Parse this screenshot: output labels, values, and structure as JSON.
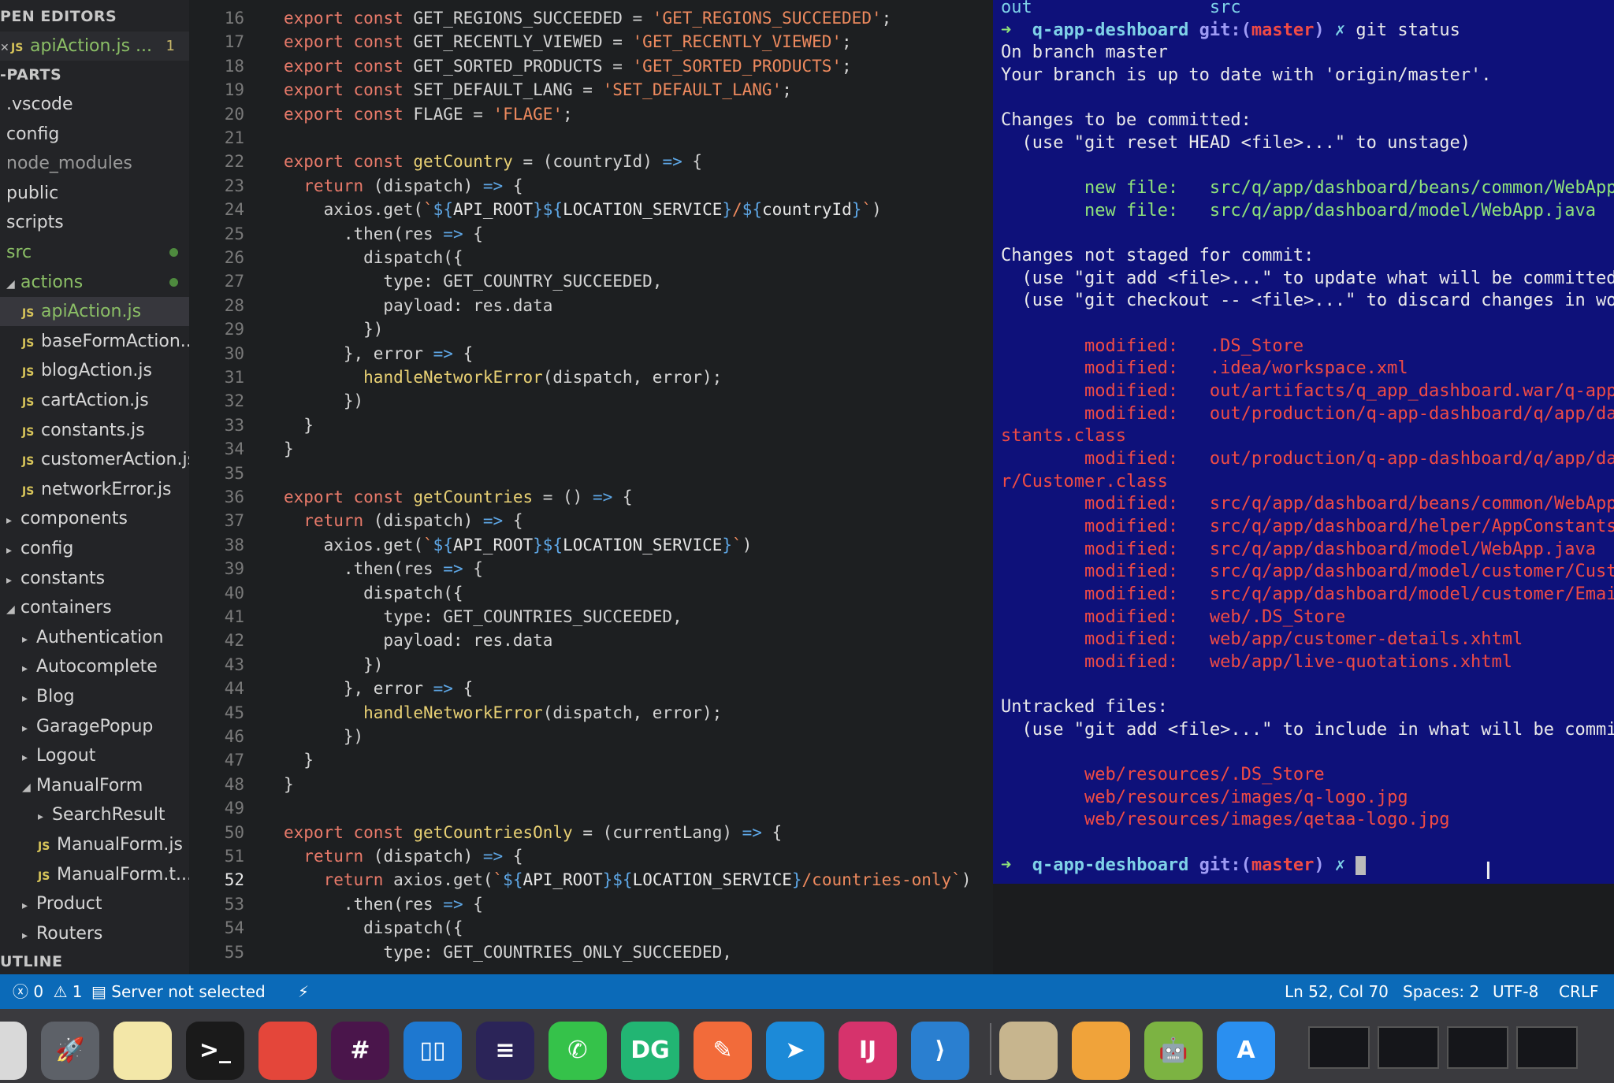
{
  "sidebar": {
    "open_editors_title": "PEN EDITORS",
    "open_editor": {
      "label": "apiAction.js ...",
      "badge": "1"
    },
    "project_title": "-PARTS",
    "outline_title": "UTLINE",
    "items": [
      {
        "label": ".vscode",
        "type": "folder",
        "indent": 0
      },
      {
        "label": "config",
        "type": "folder",
        "indent": 0
      },
      {
        "label": "node_modules",
        "type": "folder",
        "indent": 0,
        "dim": true
      },
      {
        "label": "public",
        "type": "folder",
        "indent": 0
      },
      {
        "label": "scripts",
        "type": "folder",
        "indent": 0
      },
      {
        "label": "src",
        "type": "folder",
        "indent": 0,
        "green": true,
        "dot": true
      },
      {
        "label": "actions",
        "type": "folder-open",
        "indent": 0,
        "green": true,
        "dot": true
      },
      {
        "label": "apiAction.js",
        "type": "file",
        "indent": 1,
        "green": true,
        "badge": "1",
        "selected": true
      },
      {
        "label": "baseFormAction...",
        "type": "file",
        "indent": 1
      },
      {
        "label": "blogAction.js",
        "type": "file",
        "indent": 1
      },
      {
        "label": "cartAction.js",
        "type": "file",
        "indent": 1
      },
      {
        "label": "constants.js",
        "type": "file",
        "indent": 1
      },
      {
        "label": "customerAction.js",
        "type": "file",
        "indent": 1
      },
      {
        "label": "networkError.js",
        "type": "file",
        "indent": 1
      },
      {
        "label": "components",
        "type": "folder",
        "indent": 0
      },
      {
        "label": "config",
        "type": "folder",
        "indent": 0
      },
      {
        "label": "constants",
        "type": "folder",
        "indent": 0
      },
      {
        "label": "containers",
        "type": "folder-open",
        "indent": 0
      },
      {
        "label": "Authentication",
        "type": "folder",
        "indent": 1
      },
      {
        "label": "Autocomplete",
        "type": "folder",
        "indent": 1
      },
      {
        "label": "Blog",
        "type": "folder",
        "indent": 1
      },
      {
        "label": "GaragePopup",
        "type": "folder",
        "indent": 1
      },
      {
        "label": "Logout",
        "type": "folder",
        "indent": 1
      },
      {
        "label": "ManualForm",
        "type": "folder-open",
        "indent": 1
      },
      {
        "label": "SearchResult",
        "type": "folder",
        "indent": 2
      },
      {
        "label": "ManualForm.js",
        "type": "file",
        "indent": 2
      },
      {
        "label": "ManualForm.t...",
        "type": "file",
        "indent": 2
      },
      {
        "label": "Product",
        "type": "folder",
        "indent": 1
      },
      {
        "label": "Routers",
        "type": "folder",
        "indent": 1
      }
    ]
  },
  "editor": {
    "current_line": 52,
    "lines": [
      {
        "n": 16,
        "text": "export const GET_REGIONS_SUCCEEDED = 'GET_REGIONS_SUCCEEDED';"
      },
      {
        "n": 17,
        "text": "export const GET_RECENTLY_VIEWED = 'GET_RECENTLY_VIEWED';"
      },
      {
        "n": 18,
        "text": "export const GET_SORTED_PRODUCTS = 'GET_SORTED_PRODUCTS';"
      },
      {
        "n": 19,
        "text": "export const SET_DEFAULT_LANG = 'SET_DEFAULT_LANG';"
      },
      {
        "n": 20,
        "text": "export const FLAGE = 'FLAGE';"
      },
      {
        "n": 21,
        "text": ""
      },
      {
        "n": 22,
        "text": "export const getCountry = (countryId) => {"
      },
      {
        "n": 23,
        "text": "  return (dispatch) => {"
      },
      {
        "n": 24,
        "text": "    axios.get(`${API_ROOT}${LOCATION_SERVICE}/${countryId}`)"
      },
      {
        "n": 25,
        "text": "      .then(res => {"
      },
      {
        "n": 26,
        "text": "        dispatch({"
      },
      {
        "n": 27,
        "text": "          type: GET_COUNTRY_SUCCEEDED,"
      },
      {
        "n": 28,
        "text": "          payload: res.data"
      },
      {
        "n": 29,
        "text": "        })"
      },
      {
        "n": 30,
        "text": "      }, error => {"
      },
      {
        "n": 31,
        "text": "        handleNetworkError(dispatch, error);"
      },
      {
        "n": 32,
        "text": "      })"
      },
      {
        "n": 33,
        "text": "  }"
      },
      {
        "n": 34,
        "text": "}"
      },
      {
        "n": 35,
        "text": ""
      },
      {
        "n": 36,
        "text": "export const getCountries = () => {"
      },
      {
        "n": 37,
        "text": "  return (dispatch) => {"
      },
      {
        "n": 38,
        "text": "    axios.get(`${API_ROOT}${LOCATION_SERVICE}`)"
      },
      {
        "n": 39,
        "text": "      .then(res => {"
      },
      {
        "n": 40,
        "text": "        dispatch({"
      },
      {
        "n": 41,
        "text": "          type: GET_COUNTRIES_SUCCEEDED,"
      },
      {
        "n": 42,
        "text": "          payload: res.data"
      },
      {
        "n": 43,
        "text": "        })"
      },
      {
        "n": 44,
        "text": "      }, error => {"
      },
      {
        "n": 45,
        "text": "        handleNetworkError(dispatch, error);"
      },
      {
        "n": 46,
        "text": "      })"
      },
      {
        "n": 47,
        "text": "  }"
      },
      {
        "n": 48,
        "text": "}"
      },
      {
        "n": 49,
        "text": ""
      },
      {
        "n": 50,
        "text": "export const getCountriesOnly = (currentLang) => {"
      },
      {
        "n": 51,
        "text": "  return (dispatch) => {"
      },
      {
        "n": 52,
        "text": "    return axios.get(`${API_ROOT}${LOCATION_SERVICE}/countries-only`)"
      },
      {
        "n": 53,
        "text": "      .then(res => {"
      },
      {
        "n": 54,
        "text": "        dispatch({"
      },
      {
        "n": 55,
        "text": "          type: GET_COUNTRIES_ONLY_SUCCEEDED,"
      }
    ]
  },
  "terminal": {
    "lines": [
      [
        {
          "t": "out                 src",
          "c": "t-cyan"
        }
      ],
      [
        {
          "t": "➜  ",
          "c": "t-green"
        },
        {
          "t": "q-app-deshboard ",
          "c": "t-cyan t-bold"
        },
        {
          "t": "git:(",
          "c": "t-purple t-bold"
        },
        {
          "t": "master",
          "c": "t-red t-bold"
        },
        {
          "t": ") ",
          "c": "t-purple t-bold"
        },
        {
          "t": "✗ ",
          "c": "t-cyan"
        },
        {
          "t": "git status",
          "c": ""
        }
      ],
      [
        {
          "t": "On branch master",
          "c": ""
        }
      ],
      [
        {
          "t": "Your branch is up to date with 'origin/master'.",
          "c": ""
        }
      ],
      [
        {
          "t": "",
          "c": ""
        }
      ],
      [
        {
          "t": "Changes to be committed:",
          "c": ""
        }
      ],
      [
        {
          "t": "  (use \"git reset HEAD <file>...\" to unstage)",
          "c": ""
        }
      ],
      [
        {
          "t": "",
          "c": ""
        }
      ],
      [
        {
          "t": "        new file:   src/q/app/dashboard/beans/common/WebApp",
          "c": "t-green"
        }
      ],
      [
        {
          "t": "        new file:   src/q/app/dashboard/model/WebApp.java",
          "c": "t-green"
        }
      ],
      [
        {
          "t": "",
          "c": ""
        }
      ],
      [
        {
          "t": "Changes not staged for commit:",
          "c": ""
        }
      ],
      [
        {
          "t": "  (use \"git add <file>...\" to update what will be committed",
          "c": ""
        }
      ],
      [
        {
          "t": "  (use \"git checkout -- <file>...\" to discard changes in wo",
          "c": ""
        }
      ],
      [
        {
          "t": "",
          "c": ""
        }
      ],
      [
        {
          "t": "        modified:   .DS_Store",
          "c": "t-red"
        }
      ],
      [
        {
          "t": "        modified:   .idea/workspace.xml",
          "c": "t-red"
        }
      ],
      [
        {
          "t": "        modified:   out/artifacts/q_app_dashboard.war/q-app",
          "c": "t-red"
        }
      ],
      [
        {
          "t": "        modified:   out/production/q-app-dashboard/q/app/da",
          "c": "t-red"
        }
      ],
      [
        {
          "t": "stants.class",
          "c": "t-red"
        }
      ],
      [
        {
          "t": "        modified:   out/production/q-app-dashboard/q/app/da",
          "c": "t-red"
        }
      ],
      [
        {
          "t": "r/Customer.class",
          "c": "t-red"
        }
      ],
      [
        {
          "t": "        modified:   src/q/app/dashboard/beans/common/WebApp",
          "c": "t-red"
        }
      ],
      [
        {
          "t": "        modified:   src/q/app/dashboard/helper/AppConstants",
          "c": "t-red"
        }
      ],
      [
        {
          "t": "        modified:   src/q/app/dashboard/model/WebApp.java",
          "c": "t-red"
        }
      ],
      [
        {
          "t": "        modified:   src/q/app/dashboard/model/customer/Cust",
          "c": "t-red"
        }
      ],
      [
        {
          "t": "        modified:   src/q/app/dashboard/model/customer/Emai",
          "c": "t-red"
        }
      ],
      [
        {
          "t": "        modified:   web/.DS_Store",
          "c": "t-red"
        }
      ],
      [
        {
          "t": "        modified:   web/app/customer-details.xhtml",
          "c": "t-red"
        }
      ],
      [
        {
          "t": "        modified:   web/app/live-quotations.xhtml",
          "c": "t-red"
        }
      ],
      [
        {
          "t": "",
          "c": ""
        }
      ],
      [
        {
          "t": "Untracked files:",
          "c": ""
        }
      ],
      [
        {
          "t": "  (use \"git add <file>...\" to include in what will be commi",
          "c": ""
        }
      ],
      [
        {
          "t": "",
          "c": ""
        }
      ],
      [
        {
          "t": "        web/resources/.DS_Store",
          "c": "t-red"
        }
      ],
      [
        {
          "t": "        web/resources/images/q-logo.jpg",
          "c": "t-red"
        }
      ],
      [
        {
          "t": "        web/resources/images/qetaa-logo.jpg",
          "c": "t-red"
        }
      ],
      [
        {
          "t": "",
          "c": ""
        }
      ],
      [
        {
          "t": "➜  ",
          "c": "t-green"
        },
        {
          "t": "q-app-deshboard ",
          "c": "t-cyan t-bold"
        },
        {
          "t": "git:(",
          "c": "t-purple t-bold"
        },
        {
          "t": "master",
          "c": "t-red t-bold"
        },
        {
          "t": ") ",
          "c": "t-purple t-bold"
        },
        {
          "t": "✗ ",
          "c": "t-cyan"
        }
      ]
    ]
  },
  "statusbar": {
    "errors": "0",
    "warnings": "1",
    "server": "Server not selected",
    "position": "Ln 52, Col 70",
    "spaces": "Spaces: 2",
    "encoding": "UTF-8",
    "eol": "CRLF"
  },
  "dock": {
    "icons": [
      {
        "name": "finder-icon",
        "label": "",
        "bg": "#d9d9d9"
      },
      {
        "name": "launchpad-icon",
        "label": "🚀",
        "bg": "#5d6168"
      },
      {
        "name": "notes-icon",
        "label": "",
        "bg": "#f3e7a8"
      },
      {
        "name": "terminal-icon",
        "label": ">_",
        "bg": "#1a1a1a"
      },
      {
        "name": "chrome-icon",
        "label": "",
        "bg": "#e4463a"
      },
      {
        "name": "slack-icon",
        "label": "#",
        "bg": "#4a154b"
      },
      {
        "name": "trello-icon",
        "label": "▯▯",
        "bg": "#1e78d0"
      },
      {
        "name": "eclipse-icon",
        "label": "≡",
        "bg": "#2b2458"
      },
      {
        "name": "whatsapp-icon",
        "label": "✆",
        "bg": "#35c24a"
      },
      {
        "name": "datagrip-icon",
        "label": "DG",
        "bg": "#22b573"
      },
      {
        "name": "postman-icon",
        "label": "✎",
        "bg": "#f26b3a"
      },
      {
        "name": "paw-icon",
        "label": "➤",
        "bg": "#1c8ad8"
      },
      {
        "name": "intellij-icon",
        "label": "IJ",
        "bg": "#d6336c"
      },
      {
        "name": "vscode-icon",
        "label": "⟩",
        "bg": "#2a7fd0"
      },
      {
        "name": "preview-icon",
        "label": "",
        "bg": "#c7b58e"
      },
      {
        "name": "fish-app-icon",
        "label": "",
        "bg": "#f0a33a"
      },
      {
        "name": "android-studio-icon",
        "label": "🤖",
        "bg": "#7cb342"
      },
      {
        "name": "app-store-icon",
        "label": "A",
        "bg": "#2a8ff0"
      }
    ]
  }
}
